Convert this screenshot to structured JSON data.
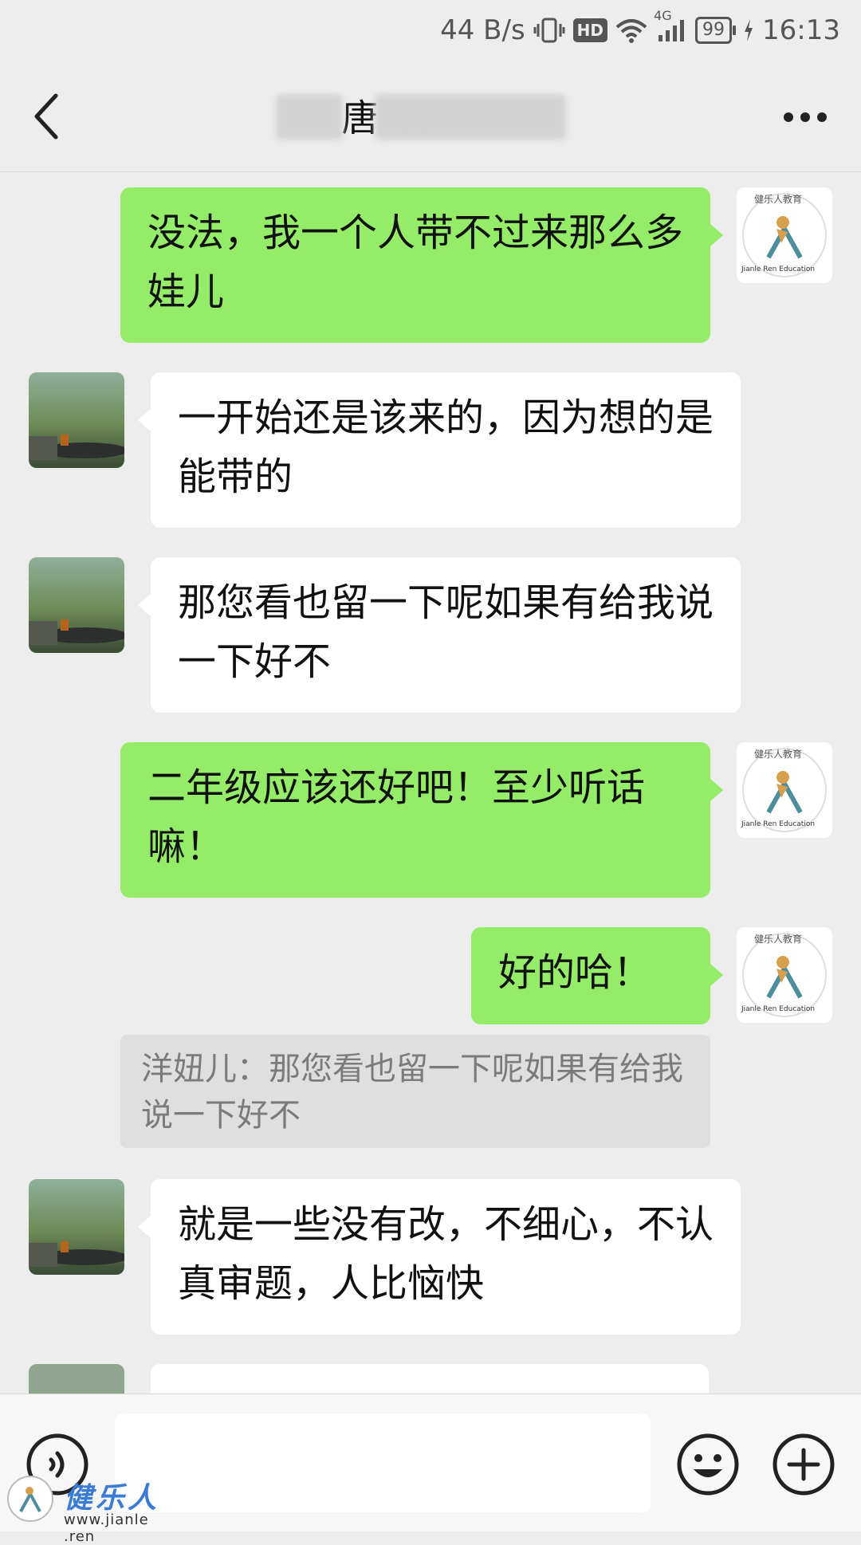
{
  "status_bar": {
    "net_speed": "44 B/s",
    "hd_badge": "HD",
    "signal_label": "4G",
    "battery": "99",
    "time": "16:13"
  },
  "header": {
    "title": "唐 君1 75"
  },
  "messages": [
    {
      "sender": "me",
      "text": "没法，我一个人带不过来那么多娃儿"
    },
    {
      "sender": "other",
      "text": "一开始还是该来的，因为想的是能带的"
    },
    {
      "sender": "other",
      "text": "那您看也留一下呢如果有给我说一下好不"
    },
    {
      "sender": "me",
      "text": "二年级应该还好吧！至少听话嘛！"
    },
    {
      "sender": "me",
      "text": "好的哈！"
    },
    {
      "sender": "other",
      "text": "就是一些没有改，不细心，不认真审题，人比恼快"
    }
  ],
  "quote": {
    "text": "洋妞儿：那您看也留一下呢如果有给我说一下好不"
  },
  "my_avatar": {
    "top_text": "健乐人教育",
    "bottom_text": "Jianle Ren Education"
  },
  "watermark": {
    "brand": "健乐人",
    "url": "www.jianle .ren"
  },
  "colors": {
    "my_bubble": "#95ec69",
    "other_bubble": "#ffffff",
    "background": "#ededed"
  }
}
